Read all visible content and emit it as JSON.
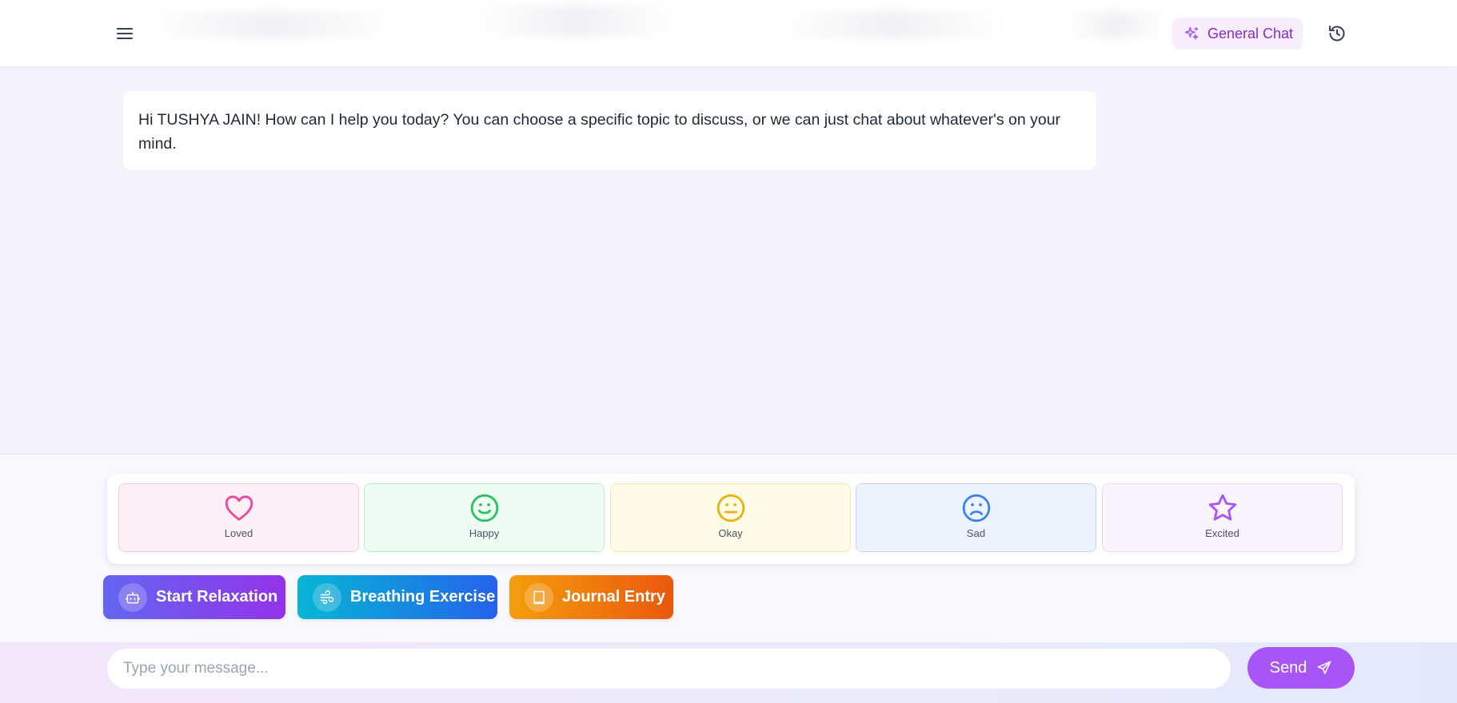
{
  "header": {
    "mode_label": "General Chat",
    "icons": {
      "menu": "hamburger-menu-icon",
      "mode": "sparkles-icon",
      "history": "history-clock-icon"
    }
  },
  "chat": {
    "messages": [
      {
        "role": "assistant",
        "text": "Hi TUSHYA JAIN! How can I help you today? You can choose a specific topic to discuss, or we can just chat about whatever's on your mind."
      }
    ]
  },
  "moods": [
    {
      "label": "Loved",
      "icon": "heart-icon",
      "color": "#ec4899",
      "bg": "#fdf0f6",
      "border": "#f9c8dd"
    },
    {
      "label": "Happy",
      "icon": "smile-icon",
      "color": "#22c55e",
      "bg": "#effbf3",
      "border": "#bbebcb"
    },
    {
      "label": "Okay",
      "icon": "meh-icon",
      "color": "#eab308",
      "bg": "#fefce9",
      "border": "#f5e8a5"
    },
    {
      "label": "Sad",
      "icon": "frown-icon",
      "color": "#3b82f6",
      "bg": "#eef4fe",
      "border": "#bfd5fb"
    },
    {
      "label": "Excited",
      "icon": "star-icon",
      "color": "#a855f7",
      "bg": "#faf4fe",
      "border": "#e8d4fc"
    }
  ],
  "actions": [
    {
      "label": "Start Relaxation",
      "icon": "robot-icon",
      "gradient": [
        "#6366f1",
        "#9333ea"
      ]
    },
    {
      "label": "Breathing Exercise",
      "icon": "wind-icon",
      "gradient": [
        "#06b6d4",
        "#2563eb"
      ]
    },
    {
      "label": "Journal Entry",
      "icon": "book-icon",
      "gradient": [
        "#f59e0b",
        "#ea580c"
      ]
    }
  ],
  "composer": {
    "placeholder": "Type your message...",
    "send_label": "Send",
    "send_icon": "paper-plane-icon"
  },
  "colors": {
    "accent": "#a855f7",
    "mode_text": "#8b2bc9",
    "mode_bg": "#f7effd"
  }
}
